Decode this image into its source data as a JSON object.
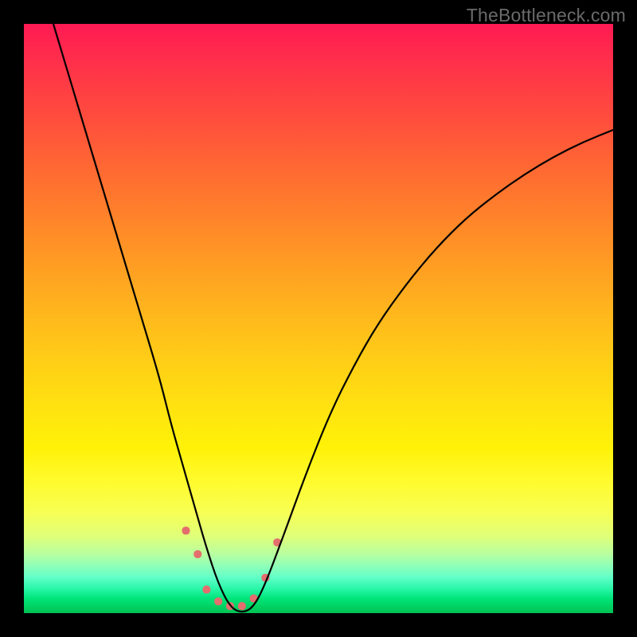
{
  "watermark": "TheBottleneck.com",
  "chart_data": {
    "type": "line",
    "title": "",
    "xlabel": "",
    "ylabel": "",
    "xlim": [
      0,
      100
    ],
    "ylim": [
      0,
      100
    ],
    "grid": false,
    "gradient_stops": [
      {
        "pct": 0,
        "color": "#ff1a53"
      },
      {
        "pct": 6,
        "color": "#ff2e4b"
      },
      {
        "pct": 15,
        "color": "#ff4a3e"
      },
      {
        "pct": 25,
        "color": "#ff6a32"
      },
      {
        "pct": 35,
        "color": "#ff8a28"
      },
      {
        "pct": 45,
        "color": "#ffaa20"
      },
      {
        "pct": 55,
        "color": "#ffc818"
      },
      {
        "pct": 65,
        "color": "#ffe210"
      },
      {
        "pct": 72,
        "color": "#fff208"
      },
      {
        "pct": 78,
        "color": "#fffb30"
      },
      {
        "pct": 83,
        "color": "#f7ff55"
      },
      {
        "pct": 87,
        "color": "#dfff7a"
      },
      {
        "pct": 90,
        "color": "#b8ffa0"
      },
      {
        "pct": 92,
        "color": "#8effb8"
      },
      {
        "pct": 94,
        "color": "#60ffc8"
      },
      {
        "pct": 96,
        "color": "#25f5a5"
      },
      {
        "pct": 97.5,
        "color": "#00e57a"
      },
      {
        "pct": 99,
        "color": "#00d060"
      },
      {
        "pct": 100,
        "color": "#00c255"
      }
    ],
    "curve": {
      "x": [
        5,
        8,
        11,
        14,
        17,
        20,
        23,
        25,
        27,
        29,
        31,
        33,
        35,
        37,
        39,
        41,
        44,
        48,
        52,
        56,
        60,
        65,
        70,
        75,
        80,
        85,
        90,
        95,
        100
      ],
      "y": [
        100,
        90,
        80,
        70,
        60,
        50,
        40,
        32,
        25,
        18,
        11,
        5,
        1,
        0,
        1,
        5,
        13,
        24,
        34,
        42,
        49,
        56,
        62,
        67,
        71,
        74.5,
        77.5,
        80,
        82
      ]
    },
    "markers": {
      "x": [
        27.5,
        29.5,
        31,
        33,
        35,
        37,
        39,
        41,
        43
      ],
      "y": [
        14,
        10,
        4,
        2,
        1.2,
        1.2,
        2.5,
        6,
        12
      ],
      "color": "#e46d6d",
      "size": 10
    }
  }
}
